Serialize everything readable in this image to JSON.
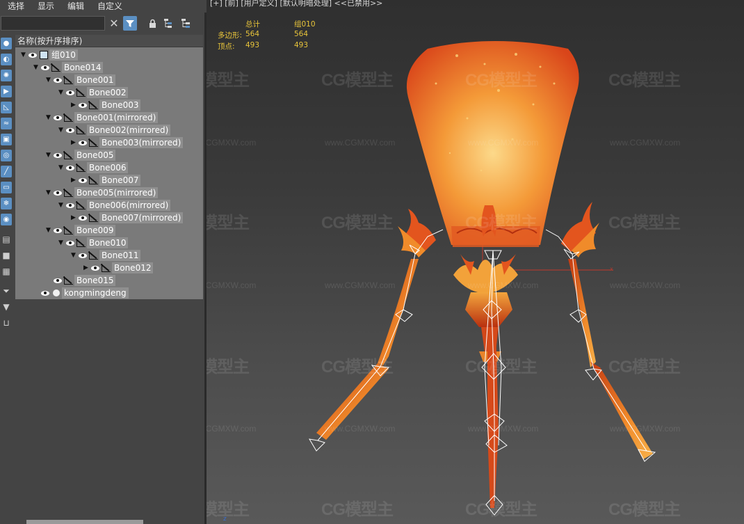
{
  "menu": [
    "选择",
    "显示",
    "编辑",
    "自定义"
  ],
  "search": {
    "value": "",
    "placeholder": ""
  },
  "toolbar": {
    "clear_icon": "close-icon",
    "filter_icon": "filter-icon",
    "lock_icon": "lock-icon",
    "hierarchy_icon": "hierarchy-icon",
    "hierarchy2_icon": "hierarchy-collapse-icon"
  },
  "explorer": {
    "header": "名称(按升序排序)",
    "rows": [
      {
        "label": "组010",
        "depth": 0,
        "type": "group",
        "arrow": "down"
      },
      {
        "label": "Bone014",
        "depth": 1,
        "type": "bone",
        "arrow": "down"
      },
      {
        "label": "Bone001",
        "depth": 2,
        "type": "bone",
        "arrow": "down"
      },
      {
        "label": "Bone002",
        "depth": 3,
        "type": "bone",
        "arrow": "down"
      },
      {
        "label": "Bone003",
        "depth": 4,
        "type": "bone",
        "arrow": "right"
      },
      {
        "label": "Bone001(mirrored)",
        "depth": 2,
        "type": "bone",
        "arrow": "down"
      },
      {
        "label": "Bone002(mirrored)",
        "depth": 3,
        "type": "bone",
        "arrow": "down"
      },
      {
        "label": "Bone003(mirrored)",
        "depth": 4,
        "type": "bone",
        "arrow": "right"
      },
      {
        "label": "Bone005",
        "depth": 2,
        "type": "bone",
        "arrow": "down"
      },
      {
        "label": "Bone006",
        "depth": 3,
        "type": "bone",
        "arrow": "down"
      },
      {
        "label": "Bone007",
        "depth": 4,
        "type": "bone",
        "arrow": "right"
      },
      {
        "label": "Bone005(mirrored)",
        "depth": 2,
        "type": "bone",
        "arrow": "down"
      },
      {
        "label": "Bone006(mirrored)",
        "depth": 3,
        "type": "bone",
        "arrow": "down"
      },
      {
        "label": "Bone007(mirrored)",
        "depth": 4,
        "type": "bone",
        "arrow": "right"
      },
      {
        "label": "Bone009",
        "depth": 2,
        "type": "bone",
        "arrow": "down"
      },
      {
        "label": "Bone010",
        "depth": 3,
        "type": "bone",
        "arrow": "down"
      },
      {
        "label": "Bone011",
        "depth": 4,
        "type": "bone",
        "arrow": "down"
      },
      {
        "label": "Bone012",
        "depth": 5,
        "type": "bone",
        "arrow": "right"
      },
      {
        "label": "Bone015",
        "depth": 2,
        "type": "bone",
        "arrow": "none"
      },
      {
        "label": "kongmingdeng",
        "depth": 1,
        "type": "mesh",
        "arrow": "none"
      }
    ]
  },
  "viewport": {
    "label": "[+] [前] [用户定义] [默认明暗处理] <<已禁用>>",
    "stats": {
      "col_total": "总计",
      "col_selected": "组010",
      "polys_label": "多边形:",
      "polys_total": "564",
      "polys_selected": "564",
      "verts_label": "顶点:",
      "verts_total": "493",
      "verts_selected": "493"
    },
    "watermark_logo": "CG模型主",
    "watermark_url": "www.CGMXW.com"
  },
  "colors": {
    "accent": "#5b8fc2",
    "stats": "#e8c43a",
    "lantern_top": "#e3551e",
    "lantern_mid": "#f39a35",
    "lantern_glow": "#fbd27a"
  }
}
